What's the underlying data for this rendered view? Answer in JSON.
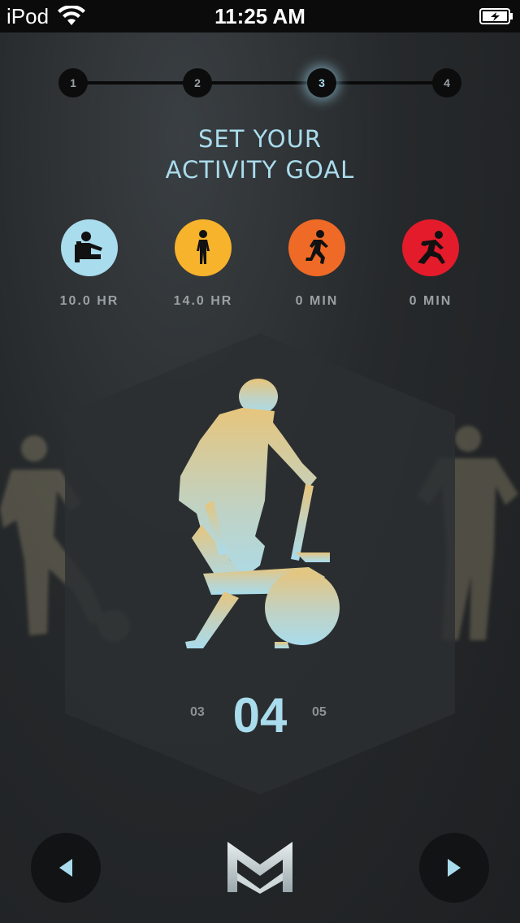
{
  "status_bar": {
    "carrier": "iPod",
    "time": "11:25 AM"
  },
  "stepper": {
    "steps": [
      "1",
      "2",
      "3",
      "4"
    ],
    "active_index": 2
  },
  "title": {
    "line1": "SET YOUR",
    "line2": "ACTIVITY GOAL"
  },
  "activity_levels": [
    {
      "icon": "sitting-icon",
      "value": "10.0 HR",
      "color": "#a9dcec"
    },
    {
      "icon": "walking-icon",
      "value": "14.0 HR",
      "color": "#f7b32b"
    },
    {
      "icon": "running-icon",
      "value": "0 MIN",
      "color": "#ef6a26"
    },
    {
      "icon": "sprinting-icon",
      "value": "0 MIN",
      "color": "#e41b2a"
    }
  ],
  "goal_picker": {
    "illustration": "stationary-bike-icon",
    "previous": "03",
    "current": "04",
    "next": "05"
  },
  "nav": {
    "prev_icon": "arrow-left-icon",
    "next_icon": "arrow-right-icon",
    "logo_icon": "misfit-logo-icon"
  },
  "colors": {
    "accent": "#a9dcec",
    "background": "#26292b"
  }
}
